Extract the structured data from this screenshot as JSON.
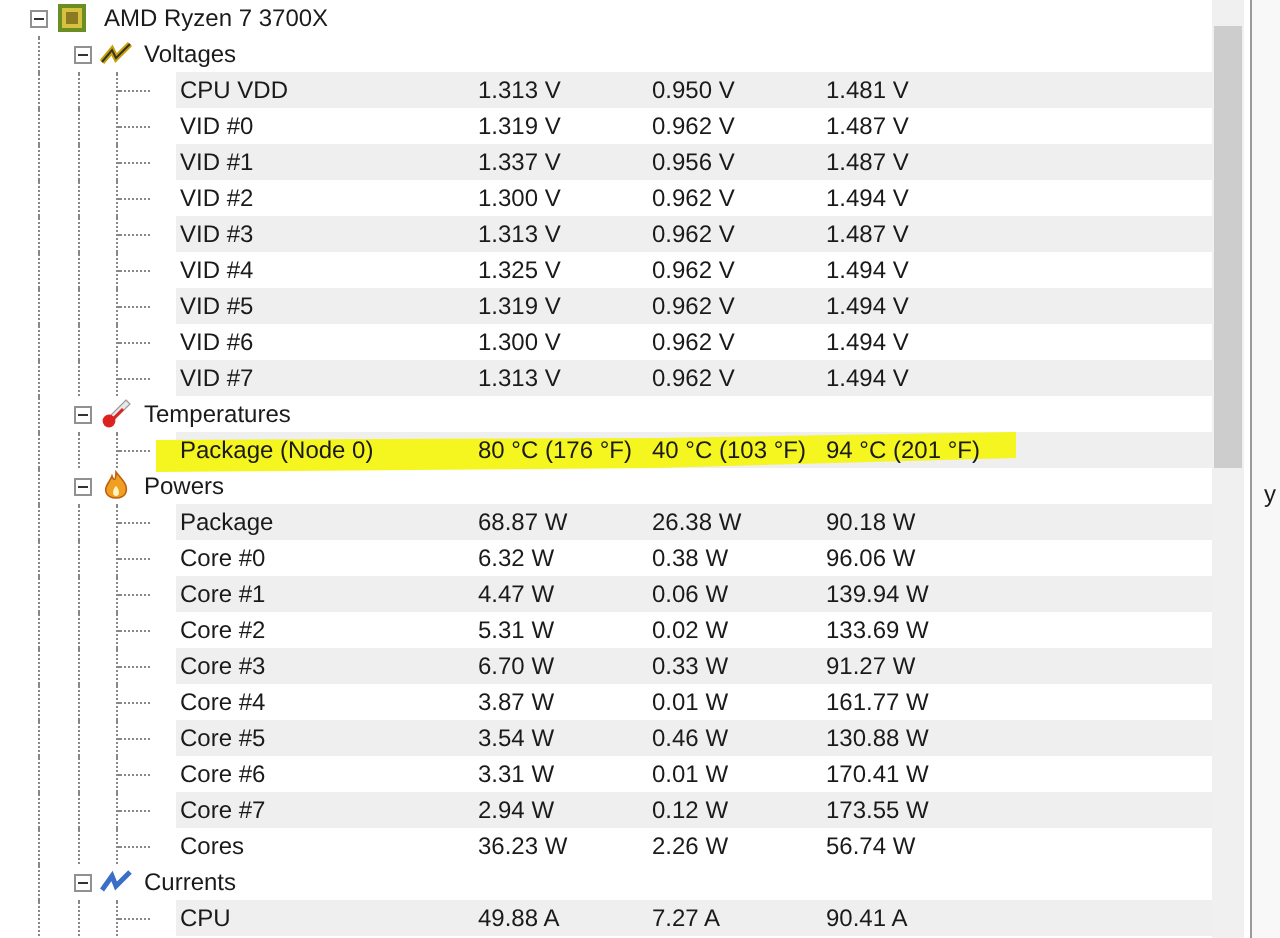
{
  "device": {
    "name": "AMD Ryzen 7 3700X",
    "expanded": true
  },
  "groups": [
    {
      "kind": "voltages",
      "name": "Voltages",
      "expanded": true,
      "sensors": [
        {
          "name": "CPU VDD",
          "value": "1.313 V",
          "min": "0.950 V",
          "max": "1.481 V",
          "highlighted": false
        },
        {
          "name": "VID #0",
          "value": "1.319 V",
          "min": "0.962 V",
          "max": "1.487 V",
          "highlighted": false
        },
        {
          "name": "VID #1",
          "value": "1.337 V",
          "min": "0.956 V",
          "max": "1.487 V",
          "highlighted": false
        },
        {
          "name": "VID #2",
          "value": "1.300 V",
          "min": "0.962 V",
          "max": "1.494 V",
          "highlighted": false
        },
        {
          "name": "VID #3",
          "value": "1.313 V",
          "min": "0.962 V",
          "max": "1.487 V",
          "highlighted": false
        },
        {
          "name": "VID #4",
          "value": "1.325 V",
          "min": "0.962 V",
          "max": "1.494 V",
          "highlighted": false
        },
        {
          "name": "VID #5",
          "value": "1.319 V",
          "min": "0.962 V",
          "max": "1.494 V",
          "highlighted": false
        },
        {
          "name": "VID #6",
          "value": "1.300 V",
          "min": "0.962 V",
          "max": "1.494 V",
          "highlighted": false
        },
        {
          "name": "VID #7",
          "value": "1.313 V",
          "min": "0.962 V",
          "max": "1.494 V",
          "highlighted": false
        }
      ]
    },
    {
      "kind": "temperatures",
      "name": "Temperatures",
      "expanded": true,
      "sensors": [
        {
          "name": "Package (Node 0)",
          "value": "80 °C  (176 °F)",
          "min": "40 °C  (103 °F)",
          "max": "94 °C  (201 °F)",
          "highlighted": true
        }
      ]
    },
    {
      "kind": "powers",
      "name": "Powers",
      "expanded": true,
      "sensors": [
        {
          "name": "Package",
          "value": "68.87 W",
          "min": "26.38 W",
          "max": "90.18 W",
          "highlighted": false
        },
        {
          "name": "Core #0",
          "value": "6.32 W",
          "min": "0.38 W",
          "max": "96.06 W",
          "highlighted": false
        },
        {
          "name": "Core #1",
          "value": "4.47 W",
          "min": "0.06 W",
          "max": "139.94 W",
          "highlighted": false
        },
        {
          "name": "Core #2",
          "value": "5.31 W",
          "min": "0.02 W",
          "max": "133.69 W",
          "highlighted": false
        },
        {
          "name": "Core #3",
          "value": "6.70 W",
          "min": "0.33 W",
          "max": "91.27 W",
          "highlighted": false
        },
        {
          "name": "Core #4",
          "value": "3.87 W",
          "min": "0.01 W",
          "max": "161.77 W",
          "highlighted": false
        },
        {
          "name": "Core #5",
          "value": "3.54 W",
          "min": "0.46 W",
          "max": "130.88 W",
          "highlighted": false
        },
        {
          "name": "Core #6",
          "value": "3.31 W",
          "min": "0.01 W",
          "max": "170.41 W",
          "highlighted": false
        },
        {
          "name": "Core #7",
          "value": "2.94 W",
          "min": "0.12 W",
          "max": "173.55 W",
          "highlighted": false
        },
        {
          "name": "Cores",
          "value": "36.23 W",
          "min": "2.26 W",
          "max": "56.74 W",
          "highlighted": false
        }
      ]
    },
    {
      "kind": "currents",
      "name": "Currents",
      "expanded": true,
      "sensors": [
        {
          "name": "CPU",
          "value": "49.88 A",
          "min": "7.27 A",
          "max": "90.41 A",
          "highlighted": false
        }
      ]
    }
  ],
  "side_panel": {
    "text": "y"
  }
}
